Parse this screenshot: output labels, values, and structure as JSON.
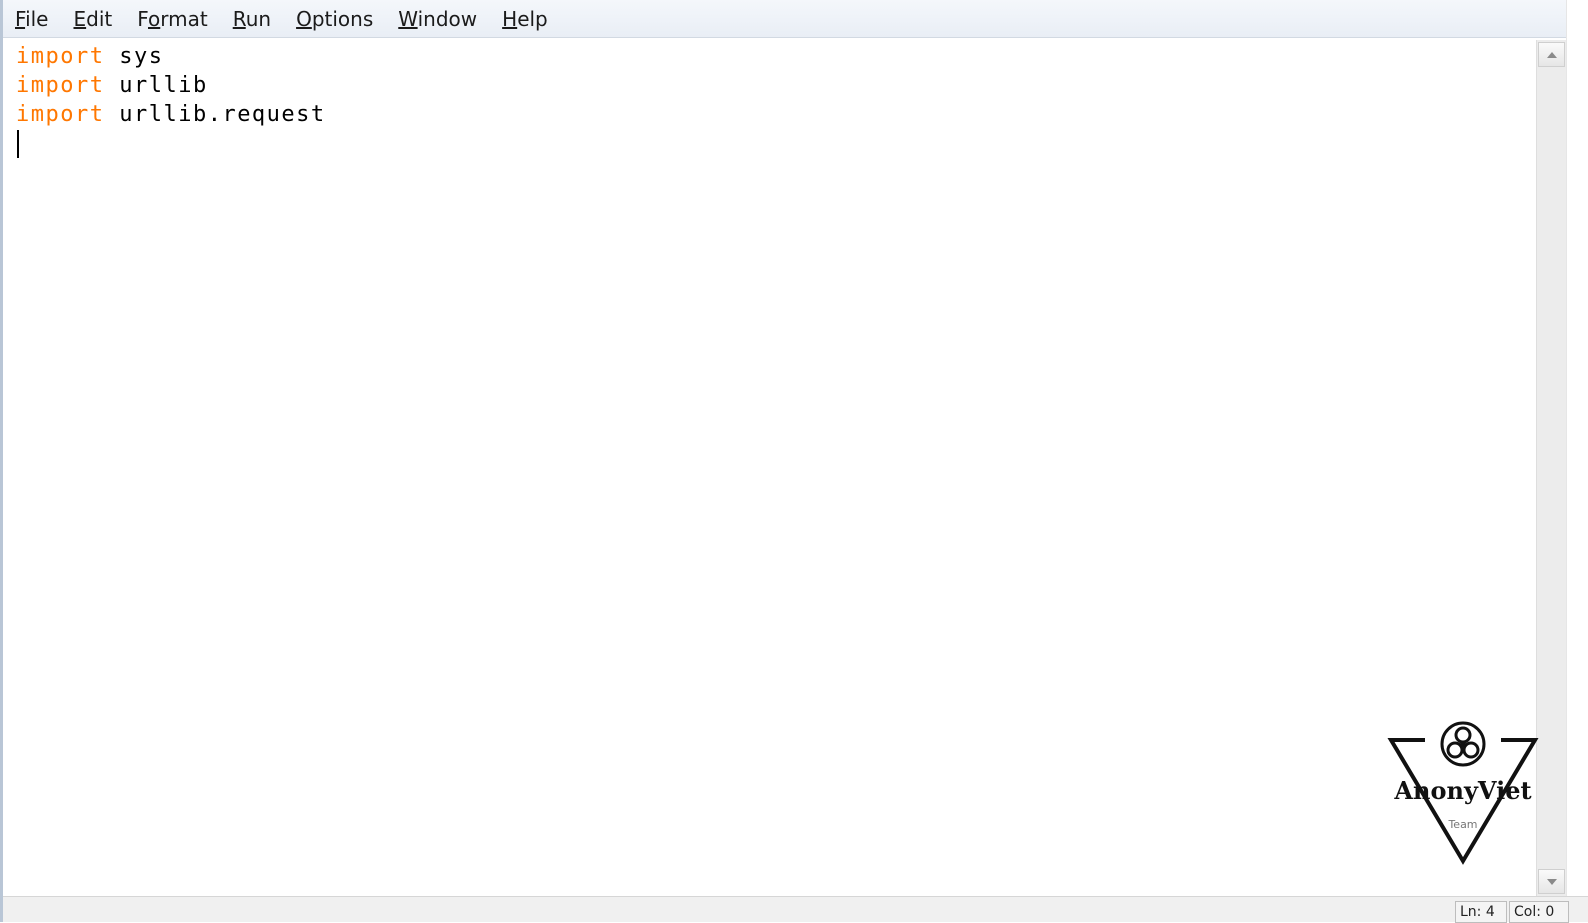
{
  "menu": [
    {
      "pre": "",
      "mn": "F",
      "post": "ile"
    },
    {
      "pre": "",
      "mn": "E",
      "post": "dit"
    },
    {
      "pre": "F",
      "mn": "o",
      "post": "rmat"
    },
    {
      "pre": "",
      "mn": "R",
      "post": "un"
    },
    {
      "pre": "",
      "mn": "O",
      "post": "ptions"
    },
    {
      "pre": "",
      "mn": "W",
      "post": "indow"
    },
    {
      "pre": "",
      "mn": "H",
      "post": "elp"
    }
  ],
  "code": [
    {
      "keyword": "import",
      "rest": " sys"
    },
    {
      "keyword": "import",
      "rest": " urllib"
    },
    {
      "keyword": "import",
      "rest": " urllib.request"
    }
  ],
  "status": {
    "line": "Ln: 4",
    "col": "Col: 0"
  },
  "logo": {
    "name": "AnonyViet",
    "sub": "Team",
    "icon": "biohazard-icon"
  },
  "colors": {
    "keyword": "#ff7700",
    "text": "#000000"
  }
}
